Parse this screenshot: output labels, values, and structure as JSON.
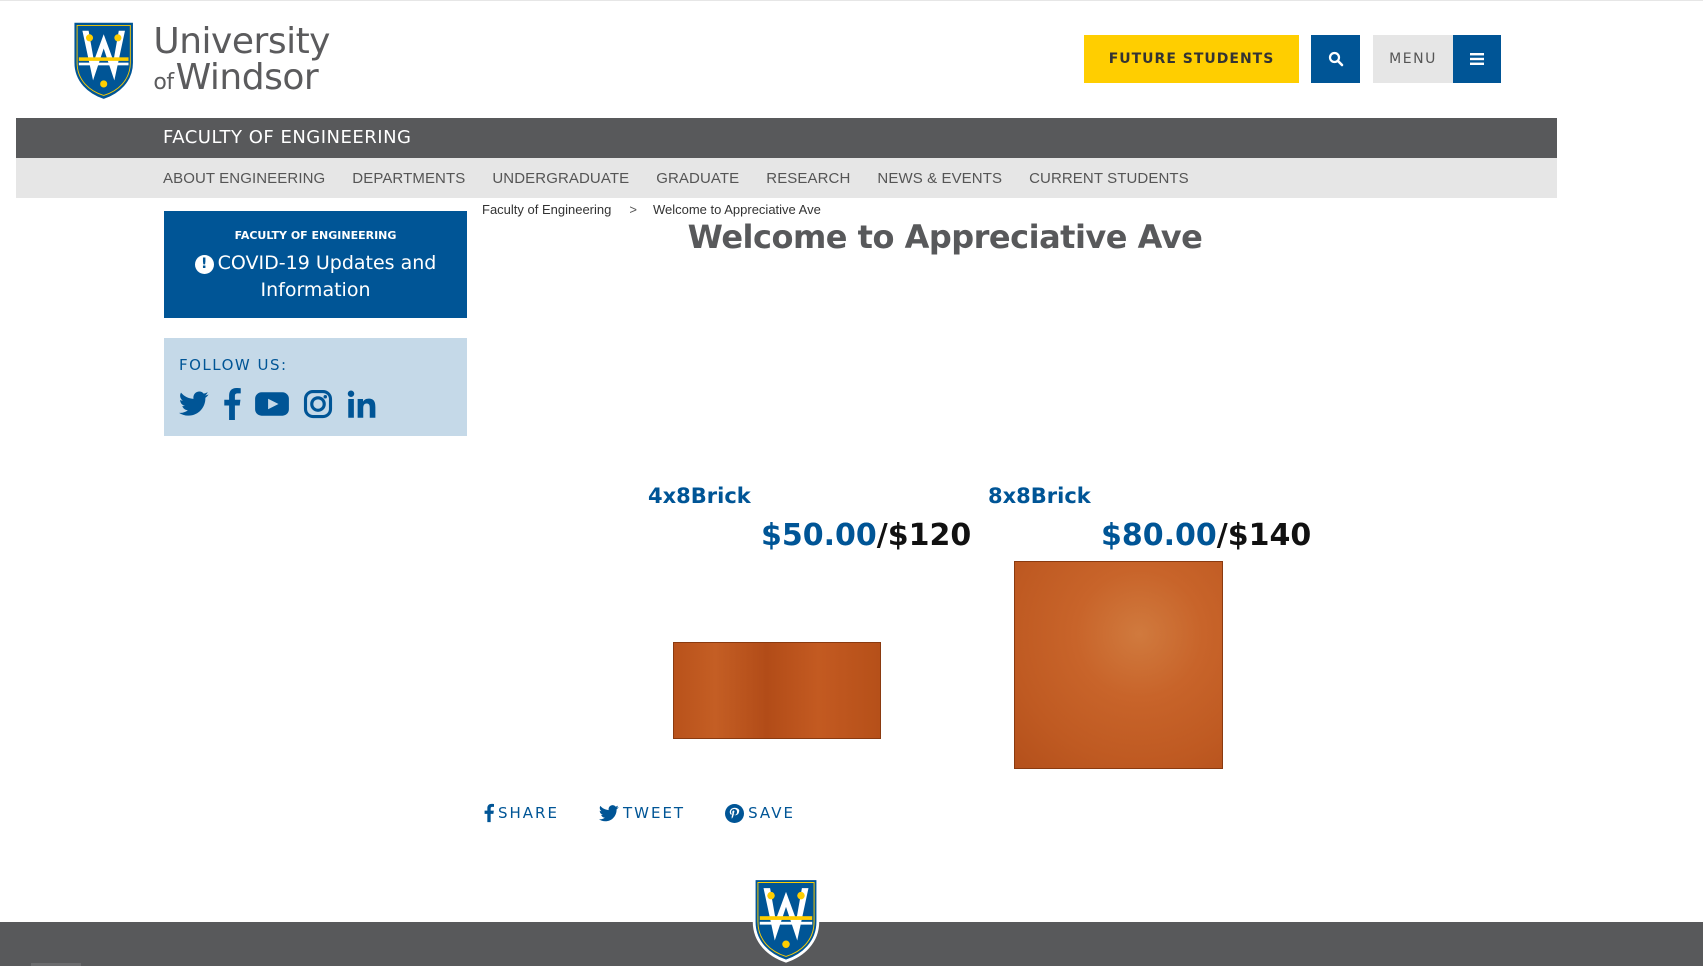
{
  "header": {
    "logo_line1": "University",
    "logo_of": "of",
    "logo_line2": "Windsor",
    "future_students_label": "FUTURE STUDENTS",
    "menu_label": "MENU"
  },
  "faculty": {
    "title": "FACULTY OF ENGINEERING"
  },
  "nav": {
    "items": [
      {
        "label": "ABOUT ENGINEERING"
      },
      {
        "label": "DEPARTMENTS"
      },
      {
        "label": "UNDERGRADUATE"
      },
      {
        "label": "GRADUATE"
      },
      {
        "label": "RESEARCH"
      },
      {
        "label": "NEWS & EVENTS"
      },
      {
        "label": "CURRENT STUDENTS"
      }
    ]
  },
  "sidebar": {
    "covid_small": "FACULTY OF ENGINEERING",
    "covid_big": "COVID-19 Updates and Information",
    "follow_label": "FOLLOW US:",
    "social_icons": [
      "twitter-icon",
      "facebook-icon",
      "youtube-icon",
      "instagram-icon",
      "linkedin-icon"
    ]
  },
  "breadcrumb": {
    "items": [
      {
        "label": "Faculty of Engineering"
      },
      {
        "label": "Welcome to Appreciative Ave"
      }
    ],
    "separator": ">"
  },
  "page": {
    "title": "Welcome to Appreciative Ave"
  },
  "products": [
    {
      "name": "4x8Brick",
      "sale_price": "$50.00",
      "original_price": "/$120"
    },
    {
      "name": "8x8Brick",
      "sale_price": "$80.00",
      "original_price": "/$140"
    }
  ],
  "share": {
    "share_label": "SHARE",
    "tweet_label": "TWEET",
    "save_label": "SAVE"
  },
  "colors": {
    "brand_blue": "#005596",
    "brand_gold": "#ffce00",
    "bar_gray": "#58595b",
    "nav_gray": "#e6e6e6",
    "follow_bg": "#c5d9e8"
  }
}
